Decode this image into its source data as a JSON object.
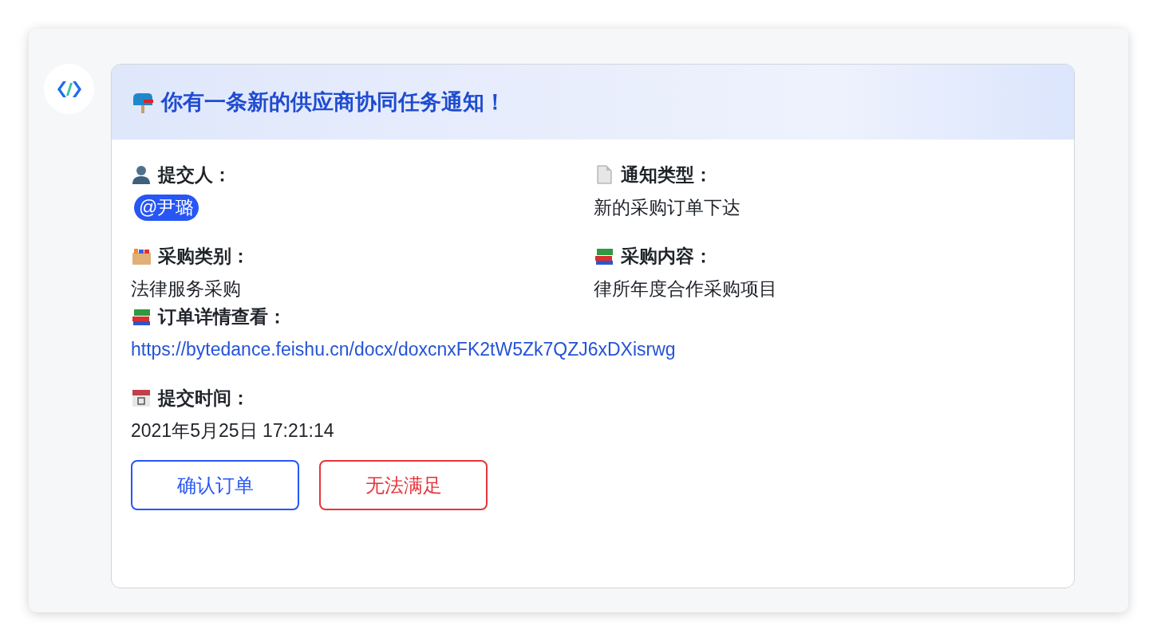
{
  "header": {
    "title": "你有一条新的供应商协同任务通知！"
  },
  "fields": [
    {
      "label": "提交人：",
      "kind": "mention",
      "value": "@尹璐"
    },
    {
      "label": "通知类型：",
      "kind": "text",
      "value": "新的采购订单下达"
    },
    {
      "label": "采购类别：",
      "kind": "text",
      "value": "法律服务采购"
    },
    {
      "label": "采购内容：",
      "kind": "text",
      "value": "律所年度合作采购项目"
    }
  ],
  "order_link": {
    "label": "订单详情查看：",
    "url": "https://bytedance.feishu.cn/docx/doxcnxFK2tW5Zk7QZJ6xDXisrwg"
  },
  "submit_time": {
    "label": "提交时间：",
    "value": "2021年5月25日 17:21:14"
  },
  "buttons": [
    {
      "label": "确认订单",
      "kind": "primary"
    },
    {
      "label": "无法满足",
      "kind": "danger"
    }
  ]
}
